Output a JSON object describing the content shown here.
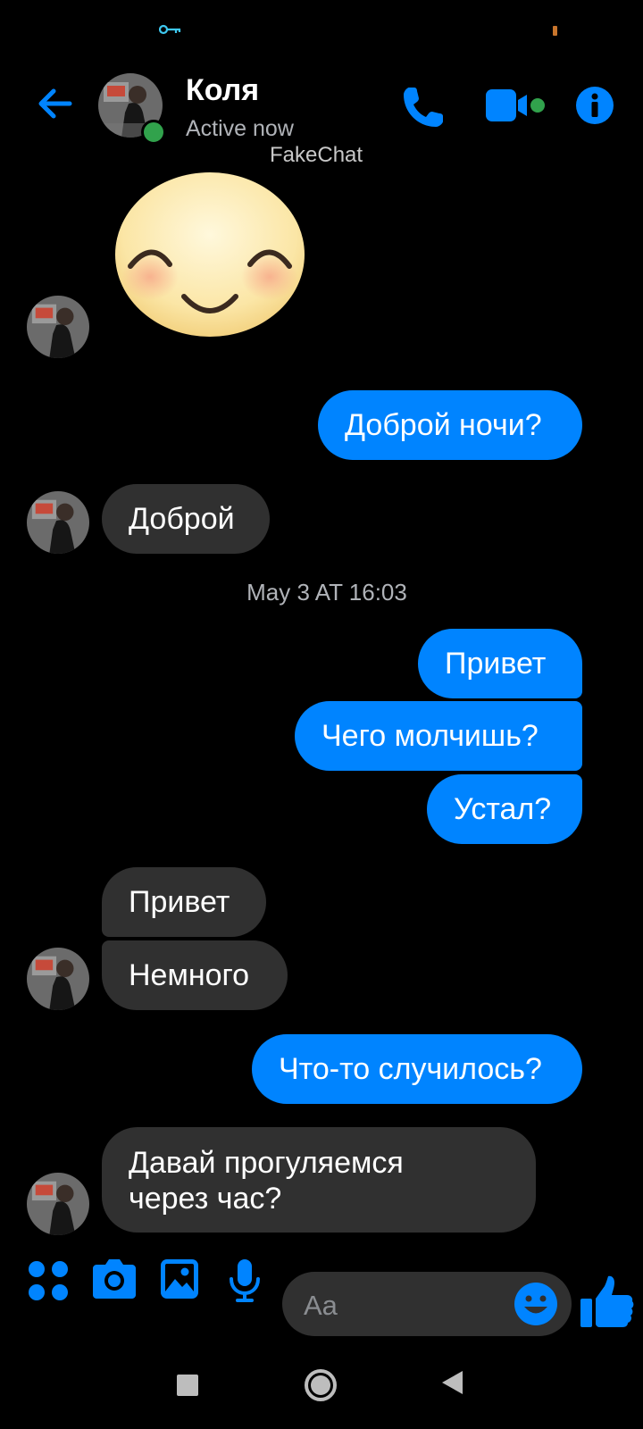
{
  "header": {
    "contact_name": "Коля",
    "status": "Active now",
    "watermark": "FakeChat"
  },
  "messages": [
    {
      "side": "in",
      "type": "sticker",
      "sticker": "smiling-face"
    },
    {
      "side": "out",
      "text": "Доброй ночи?"
    },
    {
      "side": "in",
      "text": "Доброй"
    },
    {
      "type": "timestamp",
      "text": "May 3 AT 16:03"
    },
    {
      "side": "out",
      "text": "Привет"
    },
    {
      "side": "out",
      "text": "Чего молчишь?"
    },
    {
      "side": "out",
      "text": "Устал?"
    },
    {
      "side": "in",
      "text": "Привет"
    },
    {
      "side": "in",
      "text": "Немного"
    },
    {
      "side": "out",
      "text": "Что-то случилось?"
    },
    {
      "side": "in",
      "text_line1": "Давай прогуляемся",
      "text_line2": "через час?"
    }
  ],
  "composer": {
    "placeholder": "Aa",
    "icons": [
      "menu-grid-icon",
      "camera-icon",
      "gallery-icon",
      "microphone-icon",
      "emoji-icon",
      "thumbs-up-icon"
    ]
  },
  "colors": {
    "accent": "#0084ff",
    "incoming_bubble": "#303030",
    "online": "#31a24c",
    "background": "#000000"
  }
}
